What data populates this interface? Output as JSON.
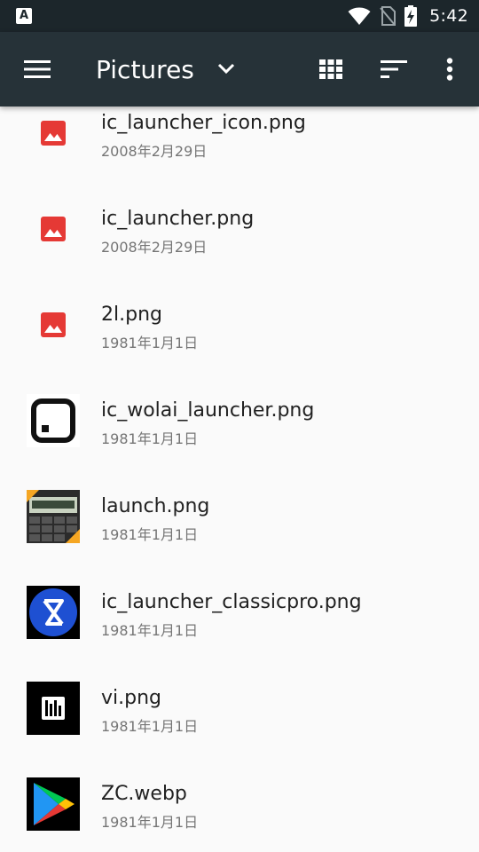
{
  "status_bar": {
    "left_icon_glyph": "A",
    "time": "5:42",
    "icons": [
      "wifi-icon",
      "no-sim-icon",
      "battery-charging-icon"
    ]
  },
  "app_bar": {
    "title": "Pictures",
    "actions": [
      "menu-icon",
      "chevron-down-icon",
      "grid-view-icon",
      "sort-icon",
      "more-vert-icon"
    ]
  },
  "files": [
    {
      "name": "ic_launcher_icon.png",
      "date": "2008年2月29日",
      "thumb": "generic-image-icon"
    },
    {
      "name": "ic_launcher.png",
      "date": "2008年2月29日",
      "thumb": "generic-image-icon"
    },
    {
      "name": "2l.png",
      "date": "1981年1月1日",
      "thumb": "generic-image-icon"
    },
    {
      "name": "ic_wolai_launcher.png",
      "date": "1981年1月1日",
      "thumb": "wolai-thumbnail"
    },
    {
      "name": "launch.png",
      "date": "1981年1月1日",
      "thumb": "calculator-thumbnail"
    },
    {
      "name": "ic_launcher_classicpro.png",
      "date": "1981年1月1日",
      "thumb": "classicpro-thumbnail"
    },
    {
      "name": "vi.png",
      "date": "1981年1月1日",
      "thumb": "equalizer-thumbnail"
    },
    {
      "name": "ZC.webp",
      "date": "1981年1月1日",
      "thumb": "play-store-thumbnail"
    }
  ],
  "colors": {
    "status_bar": "#1c262b",
    "app_bar": "#263238",
    "background": "#fafafa",
    "image_icon_red": "#e53935",
    "primary_text": "#212121",
    "secondary_text": "#757575"
  }
}
